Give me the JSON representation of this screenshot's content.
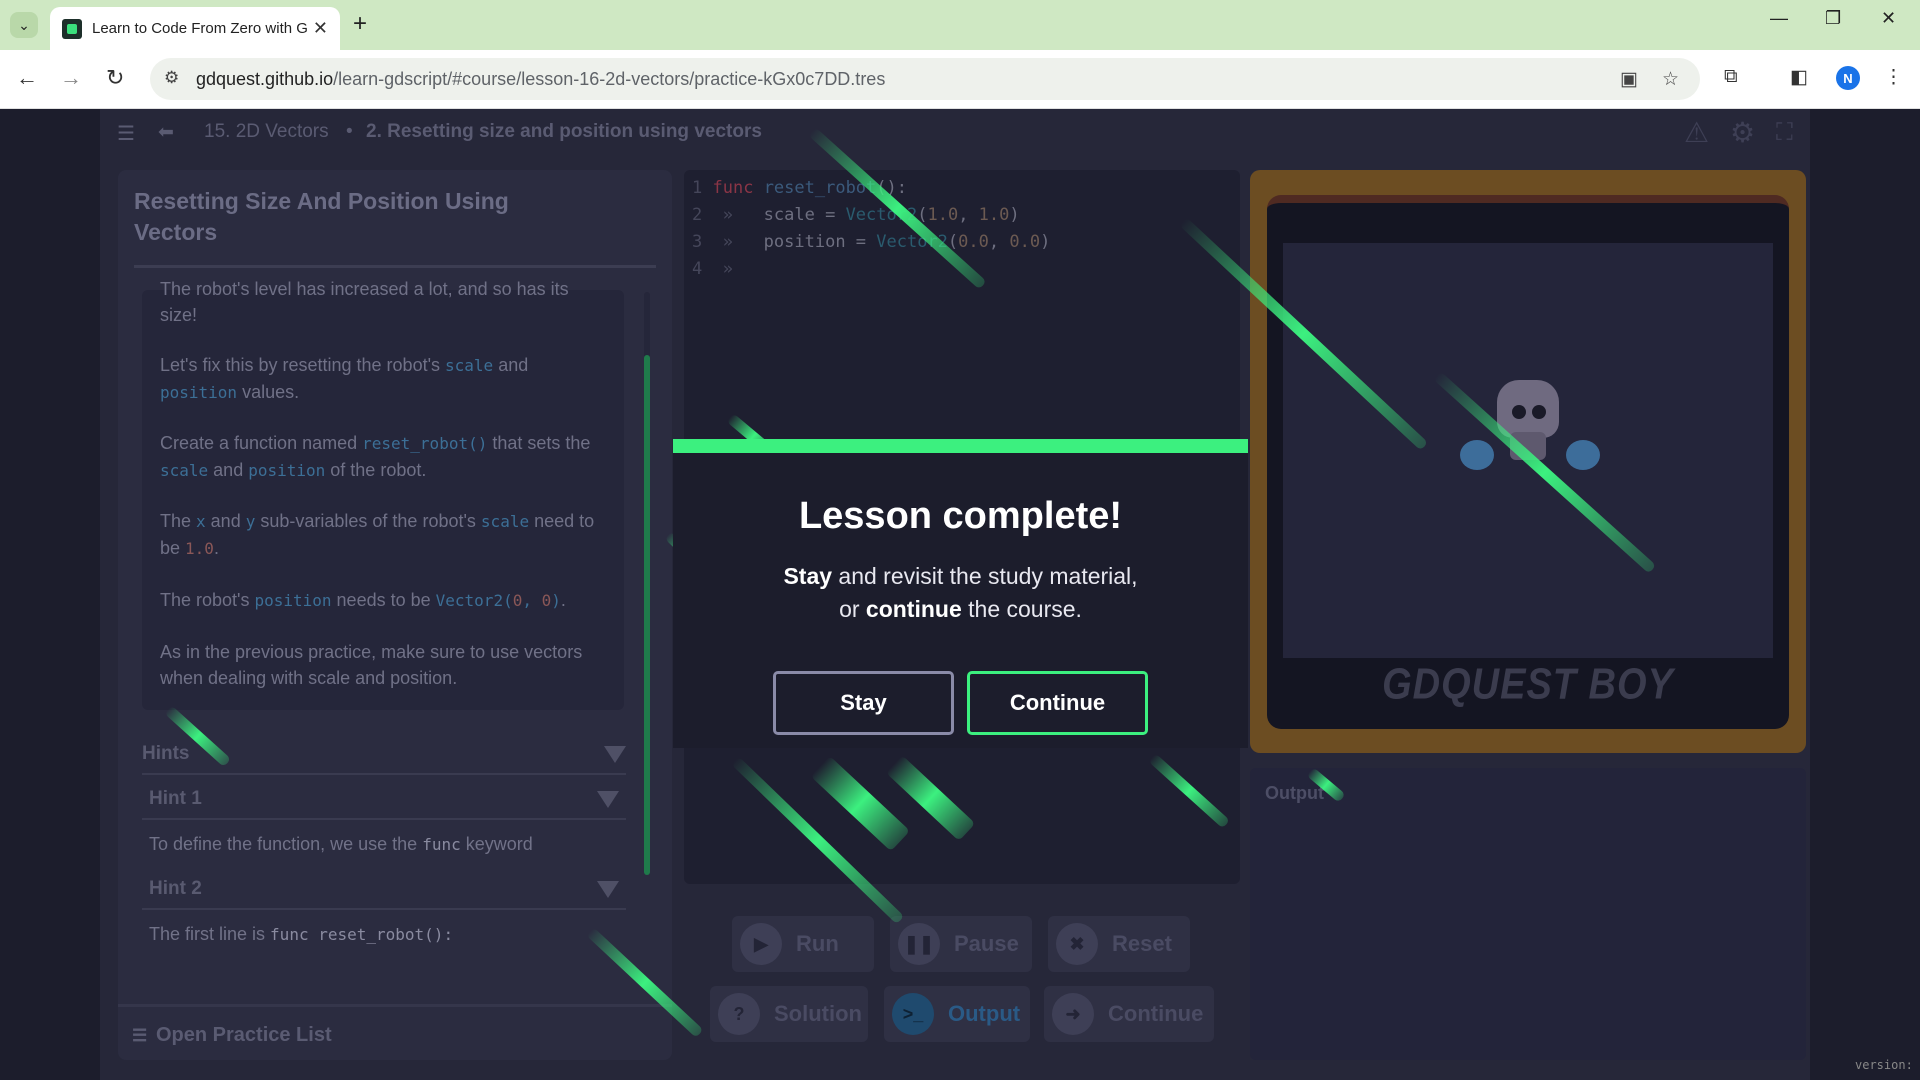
{
  "browser": {
    "tab_title": "Learn to Code From Zero with G",
    "new_tab_label": "+",
    "tab_close": "✕",
    "url_host": "gdquest.github.io",
    "url_path": "/learn-gdscript/#course/lesson-16-2d-vectors/practice-kGx0c7DD.tres",
    "profile_initial": "N"
  },
  "app": {
    "breadcrumb_lesson": "15. 2D Vectors",
    "breadcrumb_sep": "•",
    "breadcrumb_practice": "2. Resetting size and position using vectors"
  },
  "instructions": {
    "title": "Resetting Size And Position Using Vectors",
    "p0": "The robot's level has increased a lot, and so has its size!",
    "p1_a": "Let's fix this by resetting the robot's ",
    "p1_code1": "scale",
    "p1_b": " and ",
    "p1_code2": "position",
    "p1_c": " values.",
    "p2_a": "Create a function named ",
    "p2_code1": "reset_robot()",
    "p2_b": " that sets the ",
    "p2_code2": "scale",
    "p2_c": " and ",
    "p2_code3": "position",
    "p2_d": " of the robot.",
    "p3_a": "The ",
    "p3_code1": "x",
    "p3_b": " and ",
    "p3_code2": "y",
    "p3_c": " sub-variables of the robot's ",
    "p3_code3": "scale",
    "p3_d": " need to be ",
    "p3_num": "1.0",
    "p3_e": ".",
    "p4_a": "The robot's ",
    "p4_code1": "position",
    "p4_b": " needs to be ",
    "p4_code2": "Vector2(",
    "p4_n1": "0",
    "p4_comma": ", ",
    "p4_n2": "0",
    "p4_code3": ")",
    "p4_c": ".",
    "p5": "As in the previous practice, make sure to use vectors when dealing with scale and position."
  },
  "hints": {
    "header": "Hints",
    "hint1_title": "Hint 1",
    "hint1_a": "To define the function, we use the ",
    "hint1_code": "func",
    "hint1_b": " keyword",
    "hint2_title": "Hint 2",
    "hint2_a": "The first line is ",
    "hint2_code": "func reset_robot():"
  },
  "practice_list_label": "Open Practice List",
  "editor": {
    "lines": [
      {
        "n": "1",
        "kw": "func",
        "fn": " reset_robot",
        "rest": "():"
      },
      {
        "n": "2",
        "indent": "  »   ",
        "text": "scale = ",
        "ty": "Vector2",
        "args_open": "(",
        "a1": "1.0",
        "sep": ", ",
        "a2": "1.0",
        "args_close": ")"
      },
      {
        "n": "3",
        "indent": "  »   ",
        "text": "position = ",
        "ty": "Vector2",
        "args_open": "(",
        "a1": "0.0",
        "sep": ", ",
        "a2": "0.0",
        "args_close": ")"
      },
      {
        "n": "4",
        "indent": "  »"
      }
    ]
  },
  "buttons": {
    "run": "Run",
    "pause": "Pause",
    "reset": "Reset",
    "solution": "Solution",
    "output": "Output",
    "continue": "Continue"
  },
  "game": {
    "console_brand": "GDQUEST BOY"
  },
  "output": {
    "label": "Output"
  },
  "modal": {
    "title": "Lesson complete!",
    "line1_bold": "Stay",
    "line1_rest": " and revisit the study material,",
    "line2_pre": "or ",
    "line2_bold": "continue",
    "line2_rest": " the course.",
    "stay": "Stay",
    "continue": "Continue"
  },
  "version_label": "version:",
  "colors": {
    "accent_green": "#3cf07f",
    "code_blue": "#3c6f96",
    "modal_bg": "#1c1d2c",
    "app_bg": "#262739"
  }
}
